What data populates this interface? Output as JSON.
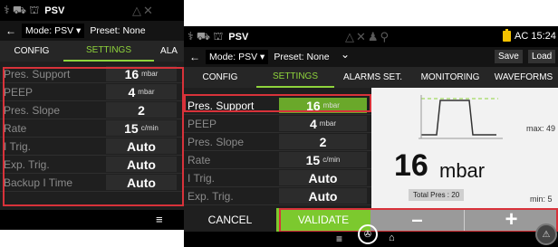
{
  "status": {
    "mode": "PSV",
    "battery_label": "AC 15:24",
    "battery_color": "#f4c200"
  },
  "modebar": {
    "arrow": "←",
    "mode_select": "Mode: PSV ▾",
    "preset": "Preset: None",
    "save_label": "Save",
    "load_label": "Load",
    "dropdown_chevron": "⌄"
  },
  "back_screen": {
    "tabs": [
      "CONFIG",
      "SETTINGS",
      "ALA"
    ],
    "params": [
      {
        "label": "Pres. Support",
        "value": "16",
        "unit": "mbar"
      },
      {
        "label": "PEEP",
        "value": "4",
        "unit": "mbar"
      },
      {
        "label": "Pres. Slope",
        "value": "2",
        "unit": ""
      },
      {
        "label": "Rate",
        "value": "15",
        "unit": "c/min"
      },
      {
        "label": "I Trig.",
        "value": "Auto",
        "unit": ""
      },
      {
        "label": "Exp. Trig.",
        "value": "Auto",
        "unit": ""
      },
      {
        "label": "Backup I Time",
        "value": "Auto",
        "unit": ""
      }
    ],
    "nav_icon": "menu-icon"
  },
  "front_screen": {
    "tabs": [
      "CONFIG",
      "SETTINGS",
      "ALARMS SET.",
      "MONITORING",
      "WAVEFORMS"
    ],
    "params": [
      {
        "label": "Pres. Support",
        "value": "16",
        "unit": "mbar",
        "selected": true
      },
      {
        "label": "PEEP",
        "value": "4",
        "unit": "mbar"
      },
      {
        "label": "Pres. Slope",
        "value": "2",
        "unit": ""
      },
      {
        "label": "Rate",
        "value": "15",
        "unit": "c/min"
      },
      {
        "label": "I Trig.",
        "value": "Auto",
        "unit": ""
      },
      {
        "label": "Exp. Trig.",
        "value": "Auto",
        "unit": ""
      }
    ],
    "big_value": "16",
    "big_unit": "mbar",
    "max_label": "max: 49",
    "min_label": "min: 5",
    "total_pres": "Total Pres : 20",
    "actions": {
      "cancel": "CANCEL",
      "validate": "VALIDATE",
      "minus": "–",
      "plus": "+"
    },
    "colors": {
      "accent_green": "#8fd43c",
      "validate_green": "#7cc92e",
      "highlight_red": "#d8323a"
    }
  }
}
